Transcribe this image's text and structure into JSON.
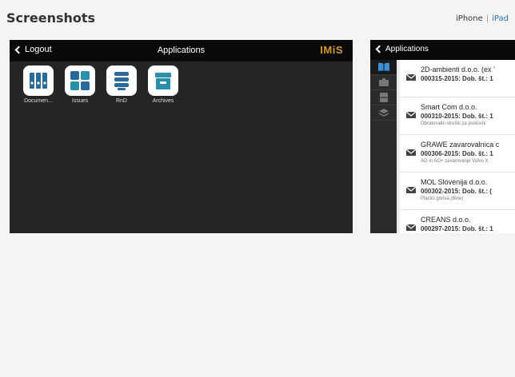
{
  "section": {
    "title": "Screenshots"
  },
  "device_switch": {
    "iphone": "iPhone",
    "separator": "|",
    "ipad": "iPad"
  },
  "shot1": {
    "back_label": "Logout",
    "title": "Applications",
    "logo": "IMiS",
    "apps": [
      {
        "label": "Documen...",
        "icon": "binders-icon",
        "color": "#2a6a9a"
      },
      {
        "label": "Issues",
        "icon": "grid-icon",
        "color": "#2a6a9a"
      },
      {
        "label": "RnD",
        "icon": "stack-icon",
        "color": "#2a6a9a"
      },
      {
        "label": "Archives",
        "icon": "archive-box-icon",
        "color": "#2a8fa8"
      }
    ]
  },
  "shot2": {
    "back_label": "Applications",
    "rows": [
      {
        "name": "2D-ambienti d.o.o. (ex ’",
        "ref": "000315-2015: Dob. št.: 1",
        "desc": ""
      },
      {
        "name": "Smart Com d.o.o.",
        "ref": "000310-2015: Dob. št.: 1",
        "desc": "Obratovalni stroški za poslovni"
      },
      {
        "name": "GRAWE zavarovalnica c",
        "ref": "000306-2015: Dob. št.: 1",
        "desc": "AO in AO+ zavarovanje Volvo X"
      },
      {
        "name": "MOL Slovenija d.o.o.",
        "ref": "000302-2015: Dob. št.: (",
        "desc": "Plačilo goriva (Bine)"
      },
      {
        "name": "CREANS d.o.o.",
        "ref": "000297-2015: Dob. št.: 1",
        "desc": ""
      }
    ]
  }
}
